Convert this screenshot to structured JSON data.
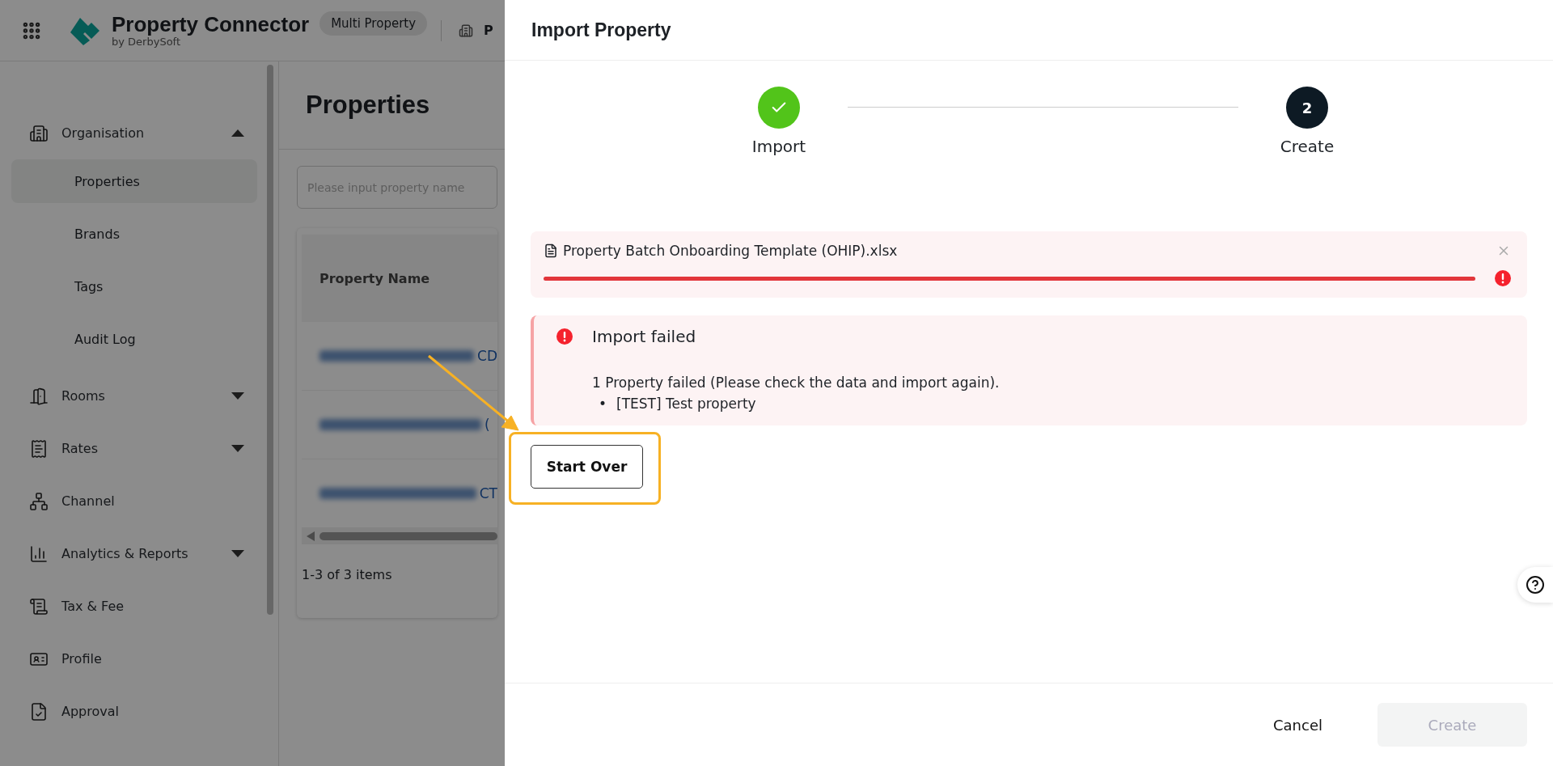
{
  "header": {
    "title": "Property Connector",
    "subtitle": "by DerbySoft",
    "badge": "Multi Property",
    "breadcrumb": "P"
  },
  "sidebar": {
    "items": [
      {
        "label": "Organisation",
        "kind": "group",
        "expanded": true,
        "children": [
          {
            "label": "Properties",
            "selected": true
          },
          {
            "label": "Brands",
            "selected": false
          },
          {
            "label": "Tags",
            "selected": false
          },
          {
            "label": "Audit Log",
            "selected": false
          }
        ]
      },
      {
        "label": "Rooms",
        "kind": "group",
        "expanded": false
      },
      {
        "label": "Rates",
        "kind": "group",
        "expanded": false
      },
      {
        "label": "Channel",
        "kind": "link"
      },
      {
        "label": "Analytics & Reports",
        "kind": "group",
        "expanded": false
      },
      {
        "label": "Tax & Fee",
        "kind": "link"
      },
      {
        "label": "Profile",
        "kind": "link"
      },
      {
        "label": "Approval",
        "kind": "link"
      }
    ]
  },
  "page": {
    "title": "Properties",
    "search": {
      "placeholder": "Please input property name"
    },
    "table": {
      "columns": [
        "Property Name"
      ],
      "rows": [
        {
          "fragment": "CD"
        },
        {
          "fragment": "("
        },
        {
          "fragment": "CT"
        }
      ]
    },
    "pagination": "1-3 of 3 items"
  },
  "drawer": {
    "title": "Import Property",
    "steps": [
      {
        "label": "Import",
        "done": true
      },
      {
        "label": "Create",
        "done": false,
        "number": "2"
      }
    ],
    "file": {
      "name": "Property Batch Onboarding Template (OHIP).xlsx",
      "level": 1,
      "failed": true
    },
    "alert": {
      "title": "Import failed",
      "message": "1 Property failed (Please check the data and import again).",
      "items": [
        {
          "marker": "•",
          "text": "[TEST] Test property"
        }
      ]
    },
    "start_over": "Start Over",
    "footer": {
      "cancel": "Cancel",
      "create": {
        "label": "Create",
        "disabled": true
      }
    }
  }
}
